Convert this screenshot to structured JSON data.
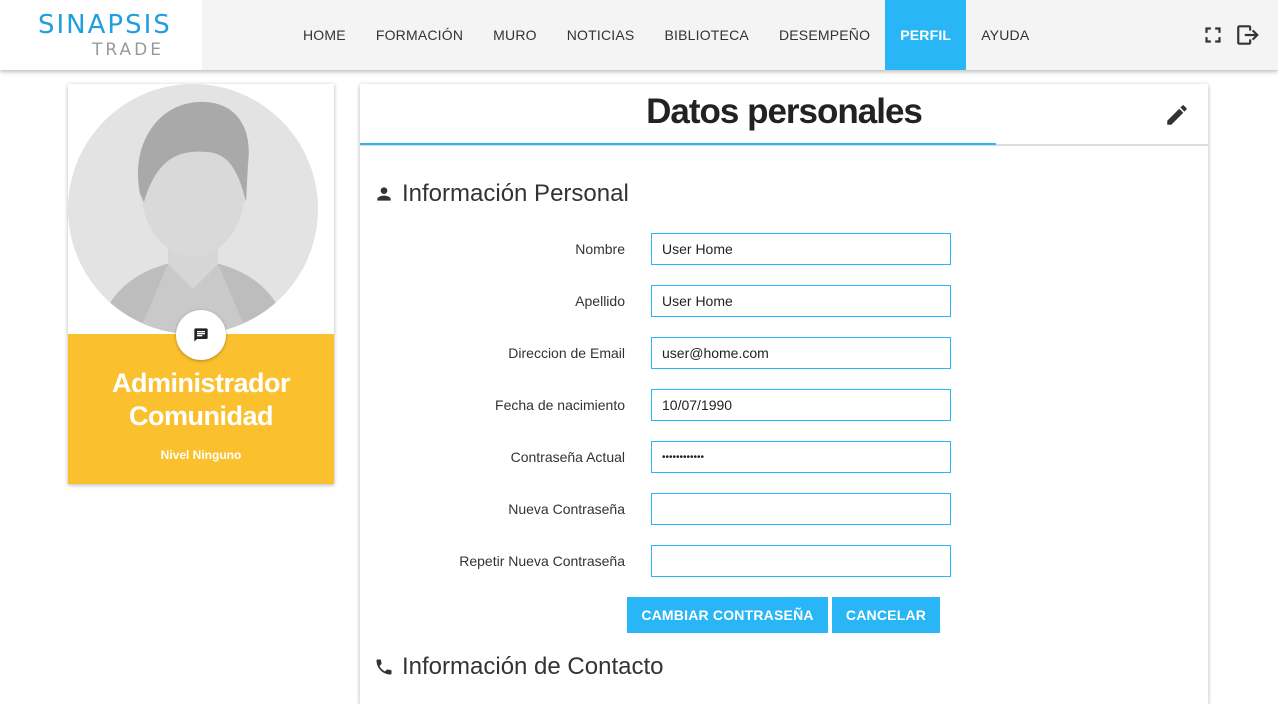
{
  "brand": {
    "name": "SINAPSIS",
    "sub": "TRADE",
    "color": "#1e9fe0"
  },
  "nav": {
    "items": [
      {
        "label": "HOME"
      },
      {
        "label": "FORMACIÓN"
      },
      {
        "label": "MURO"
      },
      {
        "label": "NOTICIAS"
      },
      {
        "label": "BIBLIOTECA"
      },
      {
        "label": "DESEMPEÑO"
      },
      {
        "label": "PERFIL",
        "active": true
      },
      {
        "label": "AYUDA"
      }
    ],
    "actions": [
      "fullscreen-icon",
      "logout-icon"
    ]
  },
  "profile": {
    "role_line1": "Administrador",
    "role_line2": "Comunidad",
    "level": "Nivel Ninguno",
    "banner_color": "#fbc02d",
    "chat_icon": "chat-icon"
  },
  "main": {
    "title": "Datos personales",
    "edit_icon": "pencil-icon",
    "section_personal": "Información Personal",
    "section_contact": "Información de Contacto",
    "fields": [
      {
        "label": "Nombre",
        "value": "User Home",
        "type": "text"
      },
      {
        "label": "Apellido",
        "value": "User Home",
        "type": "text"
      },
      {
        "label": "Direccion de Email",
        "value": "user@home.com",
        "type": "text"
      },
      {
        "label": "Fecha de nacimiento",
        "value": "10/07/1990",
        "type": "text"
      },
      {
        "label": "Contraseña Actual",
        "value": "************",
        "type": "password"
      },
      {
        "label": "Nueva Contraseña",
        "value": "",
        "type": "password"
      },
      {
        "label": "Repetir Nueva Contraseña",
        "value": "",
        "type": "password"
      }
    ],
    "buttons": {
      "change_password": "CAMBIAR CONTRASEÑA",
      "cancel": "CANCELAR"
    },
    "accent": "#29b6f6"
  }
}
